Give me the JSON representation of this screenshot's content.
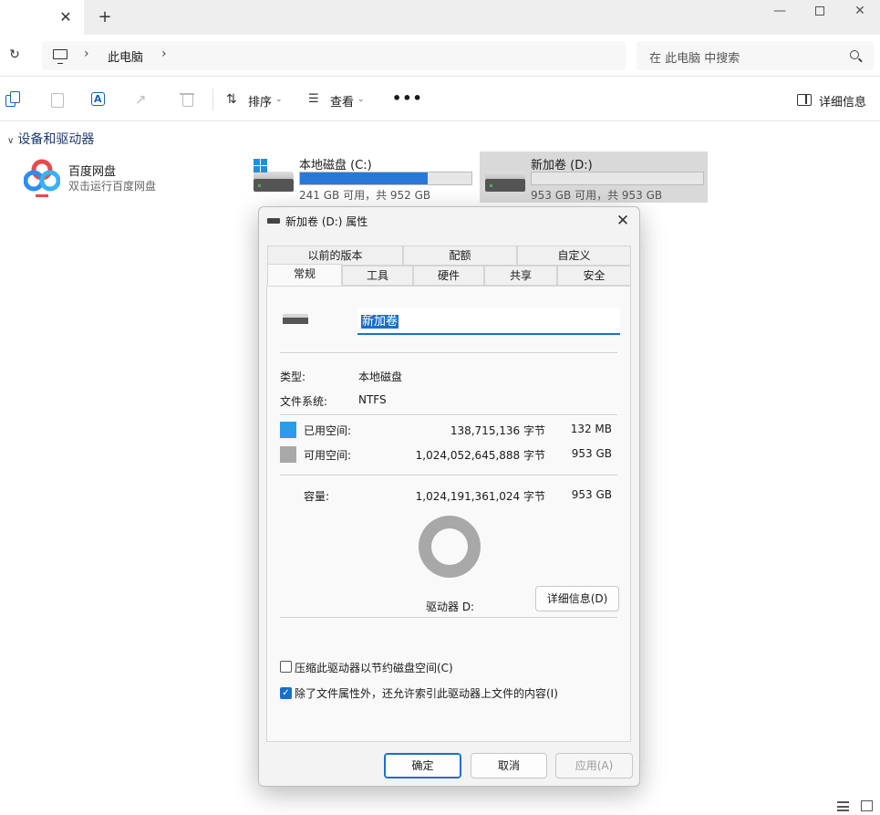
{
  "tabbar": {
    "close_glyph": "✕",
    "new_glyph": "+",
    "window_min": "—",
    "window_close": "✕"
  },
  "address": {
    "breadcrumb": "此电脑",
    "search_placeholder": "在 此电脑 中搜索"
  },
  "commands": {
    "sort_label": "排序",
    "view_label": "查看",
    "more_label": "•••",
    "details_label": "详细信息"
  },
  "section": {
    "title": "设备和驱动器"
  },
  "baidu": {
    "title": "百度网盘",
    "subtitle": "双击运行百度网盘"
  },
  "drives": [
    {
      "name": "本地磁盘 (C:)",
      "free_text": "241 GB 可用，共 952 GB",
      "used_fraction": 0.747
    },
    {
      "name": "新加卷 (D:)",
      "free_text": "953 GB 可用，共 953 GB",
      "used_fraction": 0.0
    }
  ],
  "dialog": {
    "title": "新加卷 (D:) 属性",
    "tabs_row1": [
      "以前的版本",
      "配额",
      "自定义"
    ],
    "tabs_row2": [
      "常规",
      "工具",
      "硬件",
      "共享",
      "安全"
    ],
    "name_value": "新加卷",
    "type_label": "类型:",
    "type_value": "本地磁盘",
    "fs_label": "文件系统:",
    "fs_value": "NTFS",
    "used_label": "已用空间:",
    "used_bytes": "138,715,136 字节",
    "used_size": "132 MB",
    "free_label": "可用空间:",
    "free_bytes": "1,024,052,645,888 字节",
    "free_size": "953 GB",
    "capacity_label": "容量:",
    "capacity_bytes": "1,024,191,361,024 字节",
    "capacity_size": "953 GB",
    "drive_label": "驱动器 D:",
    "details_button": "详细信息(D)",
    "compress_label": "压缩此驱动器以节约磁盘空间(C)",
    "compress_checked": false,
    "index_label": "除了文件属性外，还允许索引此驱动器上文件的内容(I)",
    "index_checked": true,
    "ok_button": "确定",
    "cancel_button": "取消",
    "apply_button": "应用(A)"
  },
  "colors": {
    "accent": "#1a6fc9",
    "used_space": "#2a9de6",
    "free_space": "#a8a8a8",
    "drive_bar": "#2a78d6"
  }
}
